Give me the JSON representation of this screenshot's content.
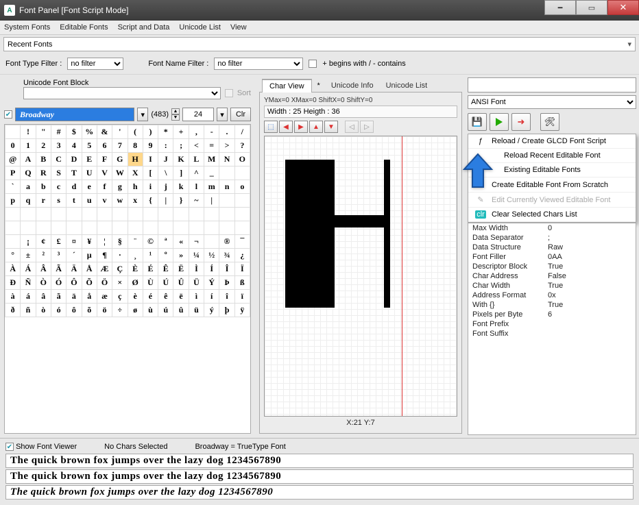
{
  "window": {
    "title": "Font Panel [Font Script Mode]"
  },
  "menu": [
    "System Fonts",
    "Editable Fonts",
    "Script and Data",
    "Unicode List",
    "View"
  ],
  "recent_fonts_label": "Recent Fonts",
  "filters": {
    "type_label": "Font Type Filter :",
    "type_value": "no filter",
    "name_label": "Font Name Filter :",
    "name_value": "no filter",
    "begins_label": "+ begins with / - contains"
  },
  "unicode_block": {
    "label": "Unicode Font Block",
    "sort": "Sort"
  },
  "font_row": {
    "name": "Broadway",
    "count": "(483)",
    "size": "24",
    "clr": "Clr"
  },
  "char_rows": [
    [
      " ",
      "!",
      "\"",
      "#",
      "$",
      "%",
      "&",
      "'",
      "(",
      ")",
      "*",
      "+",
      ",",
      "-",
      ".",
      "/"
    ],
    [
      "0",
      "1",
      "2",
      "3",
      "4",
      "5",
      "6",
      "7",
      "8",
      "9",
      ":",
      ";",
      "<",
      "=",
      ">",
      "?"
    ],
    [
      "@",
      "A",
      "B",
      "C",
      "D",
      "E",
      "F",
      "G",
      "H",
      "I",
      "J",
      "K",
      "L",
      "M",
      "N",
      "O"
    ],
    [
      "P",
      "Q",
      "R",
      "S",
      "T",
      "U",
      "V",
      "W",
      "X",
      "[",
      "\\",
      "]",
      "^",
      "_",
      " ",
      " "
    ],
    [
      "`",
      "a",
      "b",
      "c",
      "d",
      "e",
      "f",
      "g",
      "h",
      "i",
      "j",
      "k",
      "l",
      "m",
      "n",
      "o"
    ],
    [
      "p",
      "q",
      "r",
      "s",
      "t",
      "u",
      "v",
      "w",
      "x",
      "{",
      "|",
      "}",
      "~",
      "|",
      " ",
      " "
    ],
    [
      " ",
      " ",
      " ",
      " ",
      " ",
      " ",
      " ",
      " ",
      " ",
      " ",
      " ",
      " ",
      " ",
      " ",
      " ",
      " "
    ],
    [
      " ",
      " ",
      " ",
      " ",
      " ",
      " ",
      " ",
      " ",
      " ",
      " ",
      " ",
      " ",
      " ",
      " ",
      " ",
      " "
    ],
    [
      " ",
      "¡",
      "¢",
      "£",
      "¤",
      "¥",
      "¦",
      "§",
      "¨",
      "©",
      "ª",
      "«",
      "¬",
      " ",
      "®",
      "¯"
    ],
    [
      "°",
      "±",
      "²",
      "³",
      "´",
      "µ",
      "¶",
      "·",
      "¸",
      "¹",
      "º",
      "»",
      "¼",
      "½",
      "¾",
      "¿"
    ],
    [
      "À",
      "Á",
      "Â",
      "Ã",
      "Ä",
      "Å",
      "Æ",
      "Ç",
      "È",
      "É",
      "Ê",
      "Ë",
      "Ì",
      "Í",
      "Î",
      "Ï"
    ],
    [
      "Ð",
      "Ñ",
      "Ò",
      "Ó",
      "Ô",
      "Õ",
      "Ö",
      "×",
      "Ø",
      "Ù",
      "Ú",
      "Û",
      "Ü",
      "Ý",
      "Þ",
      "ß"
    ],
    [
      "à",
      "á",
      "â",
      "ã",
      "ä",
      "å",
      "æ",
      "ç",
      "è",
      "é",
      "ê",
      "ë",
      "ì",
      "í",
      "î",
      "ï"
    ],
    [
      "ð",
      "ñ",
      "ò",
      "ó",
      "ô",
      "õ",
      "ö",
      "÷",
      "ø",
      "ù",
      "ú",
      "û",
      "ü",
      "ý",
      "þ",
      "ÿ"
    ]
  ],
  "charview": {
    "tabs": {
      "char": "Char View",
      "uinfo": "Unicode Info",
      "ulist": "Unicode List"
    },
    "ymax": "YMax=0  XMax=0  ShiftX=0  ShiftY=0",
    "wh": "Width : 25  Heigth : 36",
    "status": "X:21 Y:7"
  },
  "right": {
    "ansi": "ANSI Font",
    "menu_items": {
      "reload_create": "Reload / Create GLCD Font Script",
      "reload_recent": "Reload Recent Editable Font",
      "existing": "Existing Editable Fonts",
      "from_scratch": "Create Editable Font From Scratch",
      "edit_current": "Edit Currently Viewed Editable Font",
      "clear_sel": "Clear Selected Chars List"
    },
    "props": [
      [
        "Max Width",
        "0"
      ],
      [
        "Data Separator",
        ";"
      ],
      [
        "Data Structure",
        "Raw"
      ],
      [
        "Font Filler",
        "0AA"
      ],
      [
        "Descriptor Block",
        "True"
      ],
      [
        "Char Address",
        "False"
      ],
      [
        "Char Width",
        "True"
      ],
      [
        "Address Format",
        "0x"
      ],
      [
        "With {}",
        "True"
      ],
      [
        "Pixels per Byte",
        "6"
      ],
      [
        "Font Prefix",
        ""
      ],
      [
        "Font Suffix",
        ""
      ]
    ]
  },
  "bottom": {
    "show": "Show Font Viewer",
    "nochars": "No Chars Selected",
    "tt": "Broadway = TrueType Font",
    "line": "The quick brown fox jumps over the lazy dog 1234567890"
  }
}
